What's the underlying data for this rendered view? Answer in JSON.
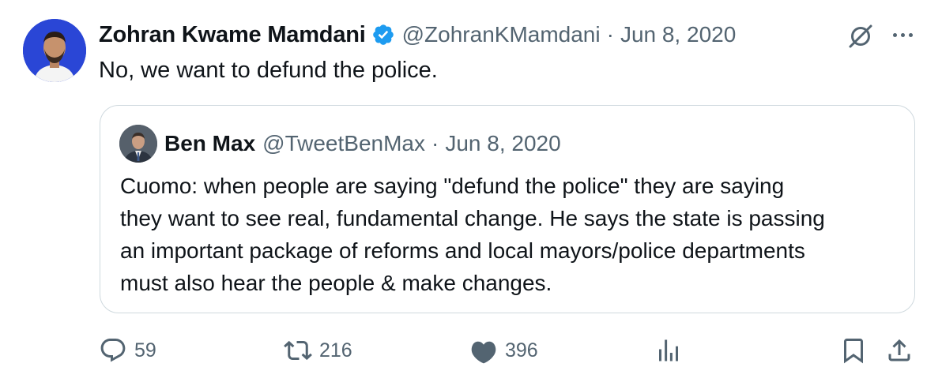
{
  "tweet": {
    "author_name": "Zohran Kwame Mamdani",
    "handle": "@ZohranKMamdani",
    "separator": "·",
    "date": "Jun 8, 2020",
    "text": "No, we want to defund the police."
  },
  "quote": {
    "author_name": "Ben Max",
    "handle": "@TweetBenMax",
    "separator": "·",
    "date": "Jun 8, 2020",
    "lines": [
      "Cuomo: when people are saying \"defund the police\" they are saying",
      "they want to see real, fundamental change. He says the state is passing",
      "an important package of reforms and local mayors/police departments",
      "must also hear the people & make changes."
    ]
  },
  "actions": {
    "replies": "59",
    "reposts": "216",
    "likes": "396"
  },
  "icons": [
    "verified-badge-icon",
    "grok-icon",
    "more-icon",
    "reply-icon",
    "repost-icon",
    "like-icon",
    "views-icon",
    "bookmark-icon",
    "share-icon"
  ],
  "colors": {
    "text": "#0f1419",
    "secondary": "#536471",
    "verified": "#1d9bf0",
    "border": "#cfd9de"
  }
}
